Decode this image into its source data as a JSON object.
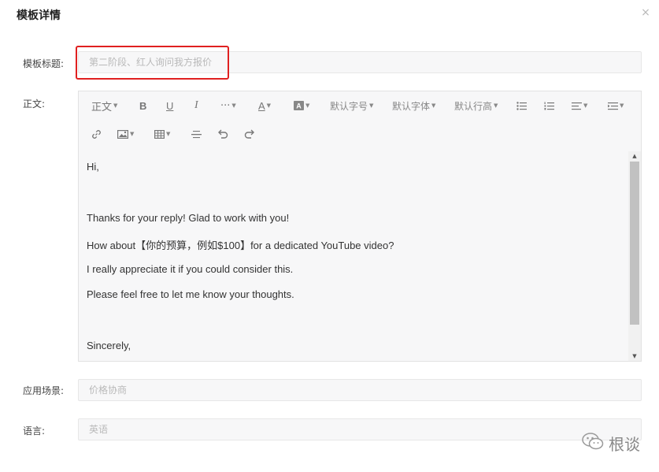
{
  "dialog": {
    "title": "模板详情",
    "close_glyph": "×"
  },
  "fields": {
    "title": {
      "label": "模板标题:",
      "placeholder": "第二阶段、红人询问我方报价"
    },
    "body": {
      "label": "正文:"
    },
    "scene": {
      "label": "应用场景:",
      "placeholder": "价格协商"
    },
    "language": {
      "label": "语言:",
      "placeholder": "英语"
    }
  },
  "toolbar": {
    "paragraph": "正文",
    "bold": "B",
    "underline": "U",
    "italic": "I",
    "more": "···",
    "font_color": "A",
    "font_size": "默认字号",
    "font_family": "默认字体",
    "line_height": "默认行高"
  },
  "email_body": {
    "line1": "Hi,",
    "line2": "Thanks for your reply! Glad to work with you!",
    "line3": "How about【你的预算，例如$100】for a dedicated YouTube video?",
    "line4": "I really appreciate it if you could consider this.",
    "line5": "Please feel free to let me know your thoughts.",
    "line6": "Sincerely,"
  },
  "scrollbar": {
    "up": "▲",
    "down": "▼",
    "position": 0
  },
  "watermark": {
    "text": "根谈"
  },
  "colors": {
    "highlight": "#e02020",
    "input_bg": "#f7f7f8"
  }
}
